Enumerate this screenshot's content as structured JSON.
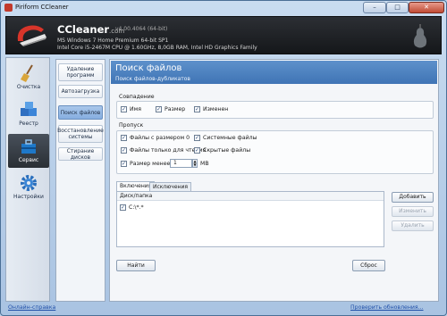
{
  "window": {
    "title": "Piriform CCleaner",
    "min": "–",
    "max": "□",
    "close": "✕"
  },
  "header": {
    "app_name": "CCleaner",
    "app_suffix": ".com",
    "version": "v4.00.4064 (64-bit)",
    "sys_line1": "MS Windows 7 Home Premium 64-bit SP1",
    "sys_line2": "Intel Core i5-2467M CPU @ 1.60GHz, 8,0GB RAM, Intel HD Graphics Family"
  },
  "sidebar": {
    "items": [
      {
        "label": "Очистка",
        "icon": "broom-icon"
      },
      {
        "label": "Реестр",
        "icon": "registry-cubes-icon"
      },
      {
        "label": "Сервис",
        "icon": "toolbox-icon"
      },
      {
        "label": "Настройки",
        "icon": "gear-icon"
      }
    ],
    "active_index": 2
  },
  "subnav": {
    "items": [
      {
        "label": "Удаление программ"
      },
      {
        "label": "Автозагрузка"
      },
      {
        "label": "Поиск файлов"
      },
      {
        "label": "Восстановление системы"
      },
      {
        "label": "Стирание дисков"
      }
    ],
    "active_index": 2
  },
  "content": {
    "title": "Поиск файлов",
    "subtitle": "Поиск файлов-дубликатов",
    "match": {
      "label": "Совпадение",
      "name": {
        "label": "Имя",
        "checked": true
      },
      "size": {
        "label": "Размер",
        "checked": true
      },
      "modified": {
        "label": "Изменен",
        "checked": true
      }
    },
    "skip": {
      "label": "Пропуск",
      "zero_size": {
        "label": "Файлы с размером 0",
        "checked": true
      },
      "system": {
        "label": "Системные файлы",
        "checked": true
      },
      "readonly": {
        "label": "Файлы только для чтения",
        "checked": true
      },
      "hidden": {
        "label": "Скрытые файлы",
        "checked": true
      },
      "size_less": {
        "label": "Размер менее",
        "checked": true,
        "value": "1",
        "unit": "MB"
      }
    },
    "tabs": [
      {
        "label": "Включения"
      },
      {
        "label": "Исключения"
      }
    ],
    "active_tab": 0,
    "list": {
      "header": "Диск/папка",
      "rows": [
        {
          "path": "C:\\*.*",
          "checked": true
        }
      ]
    },
    "buttons": {
      "add": "Добавить",
      "edit": "Изменить",
      "delete": "Удалить",
      "search": "Найти",
      "reset": "Сброс"
    }
  },
  "footer": {
    "help": "Онлайн-справка",
    "update": "Проверить обновления..."
  },
  "colors": {
    "accent": "#3f74b5",
    "link": "#1f4fa8",
    "header_bg": "#1d1f23"
  }
}
